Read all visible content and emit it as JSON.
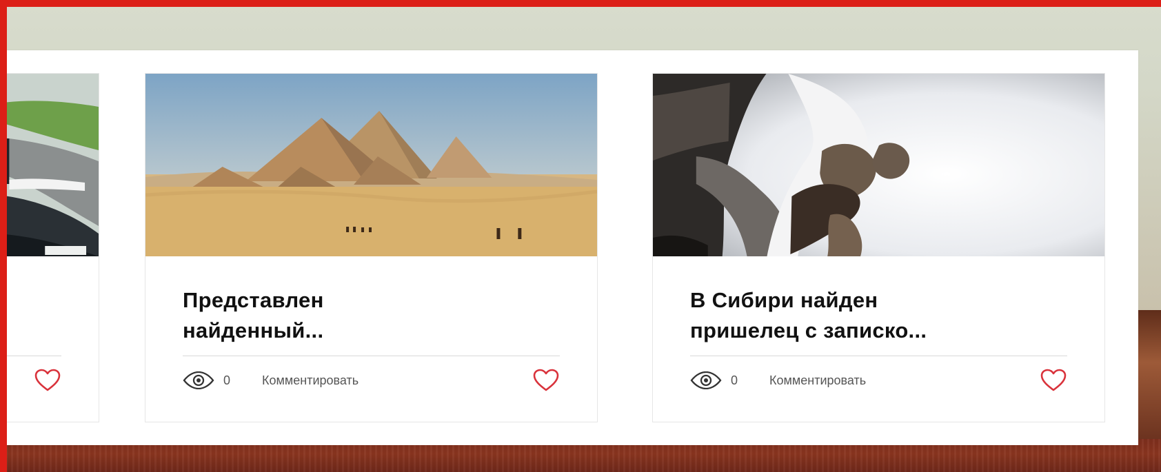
{
  "cards": [
    {
      "title": "",
      "views": "",
      "comment_label": ""
    },
    {
      "title": "Представлен\nнайденный...",
      "views": "0",
      "comment_label": "Комментировать"
    },
    {
      "title": "В Сибири найден\nпришелец с записко...",
      "views": "0",
      "comment_label": "Комментировать"
    }
  ],
  "icons": {
    "views": "eye-icon",
    "like": "heart-icon"
  },
  "colors": {
    "frame": "#dc1f17",
    "heart": "#d9323b",
    "text_meta": "#555555",
    "card_border": "#e6e6e6"
  }
}
